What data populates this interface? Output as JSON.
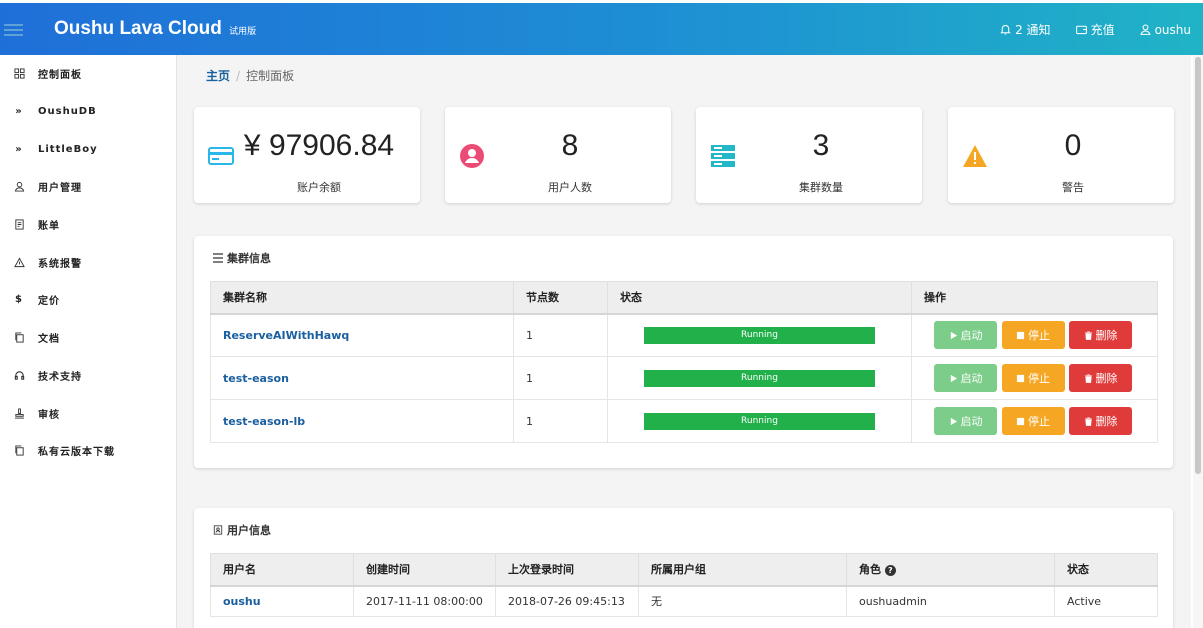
{
  "header": {
    "brand": "Oushu Lava Cloud",
    "brand_suffix": "试用版",
    "notifications": "2 通知",
    "recharge": "充值",
    "user": "oushu"
  },
  "sidebar": {
    "items": [
      {
        "label": "控制面板",
        "icon": "grid-icon"
      },
      {
        "label": "OushuDB",
        "icon": "double-chevron-icon"
      },
      {
        "label": "LittleBoy",
        "icon": "double-chevron-icon"
      },
      {
        "label": "用户管理",
        "icon": "user-icon"
      },
      {
        "label": "账单",
        "icon": "bill-icon"
      },
      {
        "label": "系统报警",
        "icon": "warning-icon"
      },
      {
        "label": "定价",
        "icon": "dollar-icon"
      },
      {
        "label": "文档",
        "icon": "docs-icon"
      },
      {
        "label": "技术支持",
        "icon": "headset-icon"
      },
      {
        "label": "审核",
        "icon": "stamp-icon"
      },
      {
        "label": "私有云版本下载",
        "icon": "download-doc-icon"
      }
    ]
  },
  "breadcrumb": {
    "home": "主页",
    "current": "控制面板"
  },
  "stats": [
    {
      "value": "¥ 97906.84",
      "label": "账户余额",
      "icon": "card-icon",
      "color": "#29b6e8"
    },
    {
      "value": "8",
      "label": "用户人数",
      "icon": "user-circle-icon",
      "color": "#ea4c75"
    },
    {
      "value": "3",
      "label": "集群数量",
      "icon": "server-icon",
      "color": "#22b8c9"
    },
    {
      "value": "0",
      "label": "警告",
      "icon": "warning-icon",
      "color": "#f5a623"
    }
  ],
  "clusters": {
    "title": "集群信息",
    "headers": [
      "集群名称",
      "节点数",
      "状态",
      "操作"
    ],
    "rows": [
      {
        "name": "ReserveAIWithHawq",
        "nodes": "1",
        "status": "Running"
      },
      {
        "name": "test-eason",
        "nodes": "1",
        "status": "Running"
      },
      {
        "name": "test-eason-lb",
        "nodes": "1",
        "status": "Running"
      }
    ],
    "actions": {
      "start": "启动",
      "stop": "停止",
      "delete": "删除"
    }
  },
  "users": {
    "title": "用户信息",
    "headers": [
      "用户名",
      "创建时间",
      "上次登录时间",
      "所属用户组",
      "角色",
      "状态"
    ],
    "rows": [
      {
        "username": "oushu",
        "created": "2017-11-11 08:00:00",
        "last_login": "2018-07-26 09:45:13",
        "group": "无",
        "role": "oushuadmin",
        "status": "Active"
      }
    ]
  },
  "colors": {
    "running": "#22b04b",
    "start": "#7bcd89",
    "stop": "#f5a623",
    "delete": "#e03b3b",
    "link": "#1a5fa0"
  }
}
